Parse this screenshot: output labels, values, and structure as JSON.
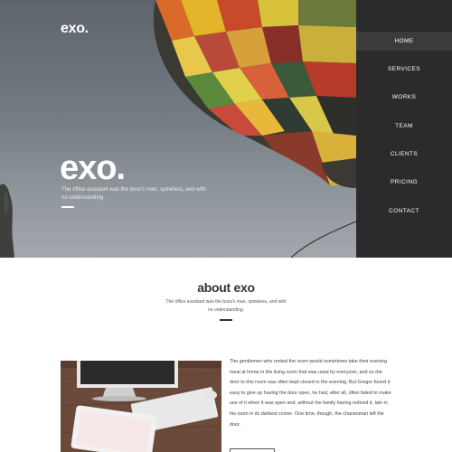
{
  "brand": {
    "logo": "exo."
  },
  "hero": {
    "title": "exo.",
    "tagline": "The office assistant was the boss's man, spineless, and with no understanding."
  },
  "nav": {
    "items": [
      {
        "label": "HOME",
        "active": true
      },
      {
        "label": "SERVICES",
        "active": false
      },
      {
        "label": "WORKS",
        "active": false
      },
      {
        "label": "TEAM",
        "active": false
      },
      {
        "label": "CLIENTS",
        "active": false
      },
      {
        "label": "PRICING",
        "active": false
      },
      {
        "label": "CONTACT",
        "active": false
      }
    ]
  },
  "about": {
    "title": "about exo",
    "text": "The office assistant was the boss's man, spineless, and with no understanding.",
    "body": "The gentlemen who rented the room would sometimes take their evening meal at home in the living room that was used by everyone, and so the door to this room was often kept closed in the evening. But Gregor found it easy to give up having the door open, he had, after all, often failed to make use of it when it was open and, without the family having noticed it, lain in his room in its darkest corner. One time, though, the charwoman left the door."
  },
  "colors": {
    "nav_bg": "#2b2b2b",
    "nav_active": "#3b3b3b",
    "text_dark": "#333333"
  }
}
